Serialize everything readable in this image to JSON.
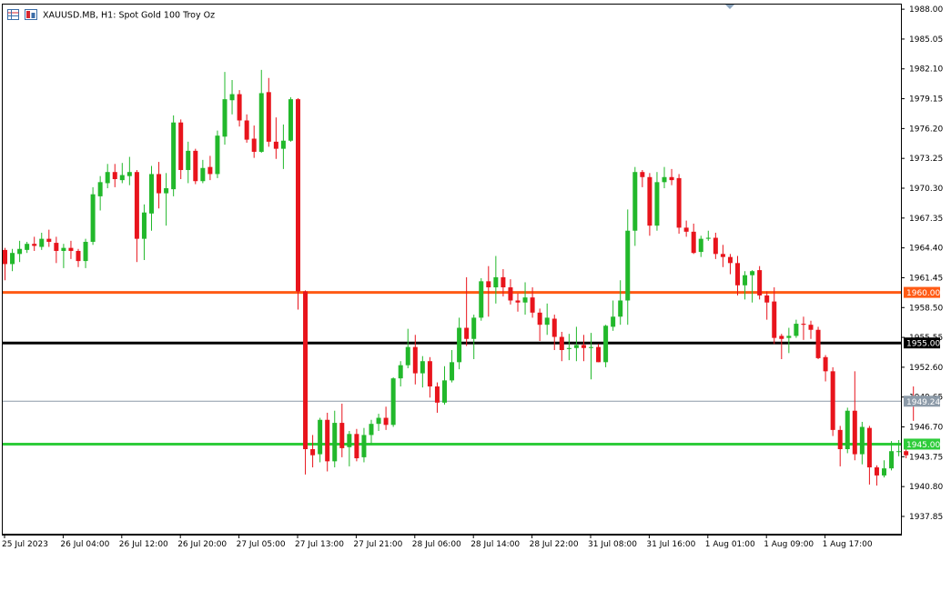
{
  "header": {
    "symbol_title": "XAUUSD.MB, H1:  Spot Gold 100 Troy Oz",
    "icons": [
      "table-icon",
      "chart-window-icon"
    ]
  },
  "chart_data": {
    "type": "candlestick",
    "symbol": "XAUUSD.MB",
    "timeframe": "H1",
    "description": "Spot Gold 100 Troy Oz",
    "ylim": [
      1936.05,
      1988.55
    ],
    "y_ticks": [
      "1988.00",
      "1985.05",
      "1982.10",
      "1979.15",
      "1976.20",
      "1973.25",
      "1970.30",
      "1967.35",
      "1964.40",
      "1961.45",
      "1958.50",
      "1955.55",
      "1952.60",
      "1949.65",
      "1946.70",
      "1943.75",
      "1940.80",
      "1937.85"
    ],
    "x_tick_labels": [
      {
        "label": "25 Jul 2023",
        "candle": 0
      },
      {
        "label": "26 Jul 04:00",
        "candle": 8
      },
      {
        "label": "26 Jul 12:00",
        "candle": 16
      },
      {
        "label": "26 Jul 20:00",
        "candle": 24
      },
      {
        "label": "27 Jul 05:00",
        "candle": 32
      },
      {
        "label": "27 Jul 13:00",
        "candle": 40
      },
      {
        "label": "27 Jul 21:00",
        "candle": 48
      },
      {
        "label": "28 Jul 06:00",
        "candle": 56
      },
      {
        "label": "28 Jul 14:00",
        "candle": 64
      },
      {
        "label": "28 Jul 22:00",
        "candle": 72
      },
      {
        "label": "31 Jul 08:00",
        "candle": 80
      },
      {
        "label": "31 Jul 16:00",
        "candle": 88
      },
      {
        "label": "1 Aug 01:00",
        "candle": 96
      },
      {
        "label": "1 Aug 09:00",
        "candle": 104
      },
      {
        "label": "1 Aug 17:00",
        "candle": 112
      }
    ],
    "colors": {
      "up": "#22b82b",
      "down": "#e8141c",
      "grid_text": "#000000"
    },
    "horizontal_lines": [
      {
        "price": 1960.0,
        "label": "1960.00",
        "color": "#ff5a14"
      },
      {
        "price": 1955.0,
        "label": "1955.00",
        "color": "#000000"
      },
      {
        "price": 1945.0,
        "label": "1945.00",
        "color": "#2ecc3a"
      },
      {
        "price": 1949.24,
        "label": "1949.24",
        "color": "#8c9aa8"
      }
    ],
    "candles": [
      [
        1964.2,
        1962.8,
        1964.4,
        1961.2
      ],
      [
        1962.8,
        1963.9,
        1964.3,
        1962.1
      ],
      [
        1963.8,
        1964.3,
        1965.1,
        1963.0
      ],
      [
        1964.2,
        1964.8,
        1965.0,
        1963.9
      ],
      [
        1964.8,
        1964.6,
        1965.5,
        1964.1
      ],
      [
        1964.5,
        1965.3,
        1965.9,
        1964.2
      ],
      [
        1965.3,
        1965.0,
        1966.2,
        1964.5
      ],
      [
        1964.9,
        1964.1,
        1965.5,
        1962.9
      ],
      [
        1964.1,
        1964.4,
        1964.8,
        1962.4
      ],
      [
        1964.4,
        1964.1,
        1965.1,
        1963.3
      ],
      [
        1964.1,
        1963.1,
        1964.3,
        1962.5
      ],
      [
        1963.1,
        1965.0,
        1965.3,
        1962.4
      ],
      [
        1965.0,
        1969.7,
        1970.4,
        1964.7
      ],
      [
        1969.5,
        1970.9,
        1971.5,
        1968.1
      ],
      [
        1970.8,
        1971.9,
        1972.7,
        1970.3
      ],
      [
        1971.9,
        1971.2,
        1972.7,
        1970.4
      ],
      [
        1971.1,
        1971.6,
        1972.8,
        1970.8
      ],
      [
        1971.5,
        1971.9,
        1973.4,
        1970.6
      ],
      [
        1971.9,
        1965.3,
        1972.1,
        1963.0
      ],
      [
        1965.3,
        1967.9,
        1968.7,
        1963.2
      ],
      [
        1967.8,
        1971.7,
        1972.5,
        1966.1
      ],
      [
        1971.7,
        1969.8,
        1972.9,
        1968.3
      ],
      [
        1969.8,
        1970.3,
        1971.8,
        1966.6
      ],
      [
        1970.2,
        1976.8,
        1977.5,
        1969.5
      ],
      [
        1976.8,
        1972.1,
        1977.1,
        1971.2
      ],
      [
        1972.1,
        1974.0,
        1974.9,
        1970.8
      ],
      [
        1974.0,
        1971.0,
        1974.2,
        1970.7
      ],
      [
        1971.0,
        1972.3,
        1973.1,
        1970.8
      ],
      [
        1972.4,
        1971.7,
        1973.5,
        1971.1
      ],
      [
        1971.7,
        1975.5,
        1976.0,
        1971.3
      ],
      [
        1975.4,
        1979.1,
        1981.8,
        1974.6
      ],
      [
        1979.0,
        1979.6,
        1981.0,
        1977.6
      ],
      [
        1979.6,
        1977.0,
        1980.0,
        1976.4
      ],
      [
        1977.0,
        1975.1,
        1977.6,
        1974.8
      ],
      [
        1975.2,
        1973.9,
        1976.5,
        1973.3
      ],
      [
        1973.9,
        1979.7,
        1982.0,
        1973.8
      ],
      [
        1979.8,
        1974.9,
        1981.2,
        1974.4
      ],
      [
        1974.9,
        1974.2,
        1977.3,
        1973.2
      ],
      [
        1974.2,
        1975.0,
        1976.6,
        1972.2
      ],
      [
        1975.0,
        1979.1,
        1979.3,
        1974.9
      ],
      [
        1979.1,
        1960.1,
        1979.2,
        1958.3
      ],
      [
        1960.1,
        1944.5,
        1960.2,
        1942.0
      ],
      [
        1944.5,
        1943.9,
        1945.9,
        1942.7
      ],
      [
        1944.0,
        1947.4,
        1947.6,
        1943.2
      ],
      [
        1947.4,
        1943.3,
        1948.1,
        1942.3
      ],
      [
        1943.3,
        1947.1,
        1948.3,
        1942.7
      ],
      [
        1947.1,
        1944.6,
        1949.0,
        1943.7
      ],
      [
        1944.7,
        1946.0,
        1946.3,
        1942.8
      ],
      [
        1946.0,
        1943.6,
        1946.5,
        1943.3
      ],
      [
        1943.7,
        1945.9,
        1946.6,
        1943.2
      ],
      [
        1945.9,
        1947.0,
        1947.4,
        1945.0
      ],
      [
        1947.0,
        1947.6,
        1948.0,
        1946.3
      ],
      [
        1947.6,
        1946.9,
        1948.7,
        1946.4
      ],
      [
        1946.9,
        1951.5,
        1951.6,
        1946.7
      ],
      [
        1951.5,
        1952.8,
        1953.2,
        1950.7
      ],
      [
        1952.8,
        1954.6,
        1956.4,
        1952.5
      ],
      [
        1954.6,
        1952.0,
        1955.8,
        1950.9
      ],
      [
        1952.0,
        1953.2,
        1953.7,
        1950.6
      ],
      [
        1953.2,
        1950.7,
        1953.6,
        1949.6
      ],
      [
        1950.7,
        1949.1,
        1951.1,
        1948.1
      ],
      [
        1949.1,
        1951.3,
        1952.7,
        1948.9
      ],
      [
        1951.3,
        1953.1,
        1954.3,
        1951.1
      ],
      [
        1953.1,
        1956.5,
        1957.5,
        1952.4
      ],
      [
        1956.5,
        1955.4,
        1961.5,
        1954.7
      ],
      [
        1955.4,
        1957.5,
        1957.8,
        1953.4
      ],
      [
        1957.5,
        1961.1,
        1961.4,
        1957.2
      ],
      [
        1961.1,
        1960.5,
        1962.6,
        1957.6
      ],
      [
        1960.5,
        1961.5,
        1963.6,
        1958.9
      ],
      [
        1961.5,
        1960.5,
        1962.3,
        1959.6
      ],
      [
        1960.5,
        1959.2,
        1961.3,
        1958.8
      ],
      [
        1959.2,
        1959.0,
        1959.9,
        1958.1
      ],
      [
        1959.0,
        1959.5,
        1961.0,
        1957.8
      ],
      [
        1959.5,
        1958.0,
        1960.5,
        1957.5
      ],
      [
        1958.0,
        1956.8,
        1958.4,
        1955.2
      ],
      [
        1956.8,
        1957.5,
        1958.9,
        1955.8
      ],
      [
        1957.4,
        1955.6,
        1957.8,
        1954.3
      ],
      [
        1955.6,
        1954.3,
        1956.1,
        1953.2
      ],
      [
        1954.4,
        1954.5,
        1955.9,
        1953.3
      ],
      [
        1954.5,
        1954.8,
        1956.6,
        1953.2
      ],
      [
        1954.8,
        1954.5,
        1955.8,
        1953.2
      ],
      [
        1954.5,
        1954.6,
        1956.0,
        1951.4
      ],
      [
        1954.6,
        1953.1,
        1954.9,
        1953.1
      ],
      [
        1953.1,
        1956.7,
        1956.8,
        1952.6
      ],
      [
        1956.6,
        1957.6,
        1959.2,
        1956.2
      ],
      [
        1957.6,
        1959.2,
        1961.2,
        1956.8
      ],
      [
        1959.2,
        1966.1,
        1968.2,
        1956.8
      ],
      [
        1966.1,
        1971.9,
        1972.4,
        1964.6
      ],
      [
        1971.9,
        1971.4,
        1972.1,
        1970.4
      ],
      [
        1971.4,
        1966.6,
        1971.8,
        1965.6
      ],
      [
        1966.6,
        1970.9,
        1971.9,
        1966.1
      ],
      [
        1970.9,
        1971.4,
        1972.4,
        1970.3
      ],
      [
        1971.4,
        1971.1,
        1972.2,
        1970.6
      ],
      [
        1971.3,
        1966.4,
        1971.7,
        1965.8
      ],
      [
        1966.4,
        1966.0,
        1967.1,
        1965.5
      ],
      [
        1966.0,
        1963.9,
        1966.8,
        1963.8
      ],
      [
        1964.0,
        1965.3,
        1965.6,
        1963.5
      ],
      [
        1965.3,
        1965.4,
        1966.1,
        1965.1
      ],
      [
        1965.4,
        1963.8,
        1965.9,
        1963.3
      ],
      [
        1963.8,
        1963.5,
        1964.7,
        1962.5
      ],
      [
        1963.5,
        1962.9,
        1963.8,
        1961.8
      ],
      [
        1962.9,
        1960.7,
        1963.6,
        1959.7
      ],
      [
        1960.7,
        1961.7,
        1962.1,
        1959.3
      ],
      [
        1961.7,
        1962.1,
        1962.2,
        1959.0
      ],
      [
        1962.2,
        1959.7,
        1962.6,
        1959.3
      ],
      [
        1959.7,
        1959.0,
        1960.1,
        1957.3
      ],
      [
        1959.1,
        1955.5,
        1960.5,
        1954.9
      ],
      [
        1955.7,
        1955.4,
        1955.9,
        1953.4
      ],
      [
        1955.5,
        1955.7,
        1956.5,
        1954.0
      ],
      [
        1955.7,
        1956.9,
        1957.3,
        1955.5
      ],
      [
        1956.9,
        1956.8,
        1957.6,
        1955.3
      ],
      [
        1956.8,
        1956.3,
        1957.2,
        1955.4
      ],
      [
        1956.3,
        1953.5,
        1956.6,
        1953.4
      ],
      [
        1953.6,
        1952.2,
        1953.8,
        1951.2
      ],
      [
        1952.2,
        1946.4,
        1952.6,
        1945.8
      ],
      [
        1946.4,
        1944.5,
        1946.8,
        1942.8
      ],
      [
        1944.5,
        1948.3,
        1948.6,
        1944.1
      ],
      [
        1948.3,
        1944.0,
        1952.2,
        1943.4
      ],
      [
        1944.0,
        1946.7,
        1947.2,
        1943.0
      ],
      [
        1946.6,
        1942.7,
        1946.8,
        1941.0
      ],
      [
        1942.7,
        1941.9,
        1942.9,
        1940.9
      ],
      [
        1941.9,
        1942.6,
        1943.4,
        1941.7
      ],
      [
        1942.6,
        1944.3,
        1945.3,
        1942.4
      ],
      [
        1944.3,
        1944.3,
        1945.4,
        1943.8
      ],
      [
        1944.3,
        1943.9,
        1944.5,
        1943.6
      ],
      [
        1949.5,
        1948.8,
        1950.7,
        1947.3
      ]
    ]
  }
}
